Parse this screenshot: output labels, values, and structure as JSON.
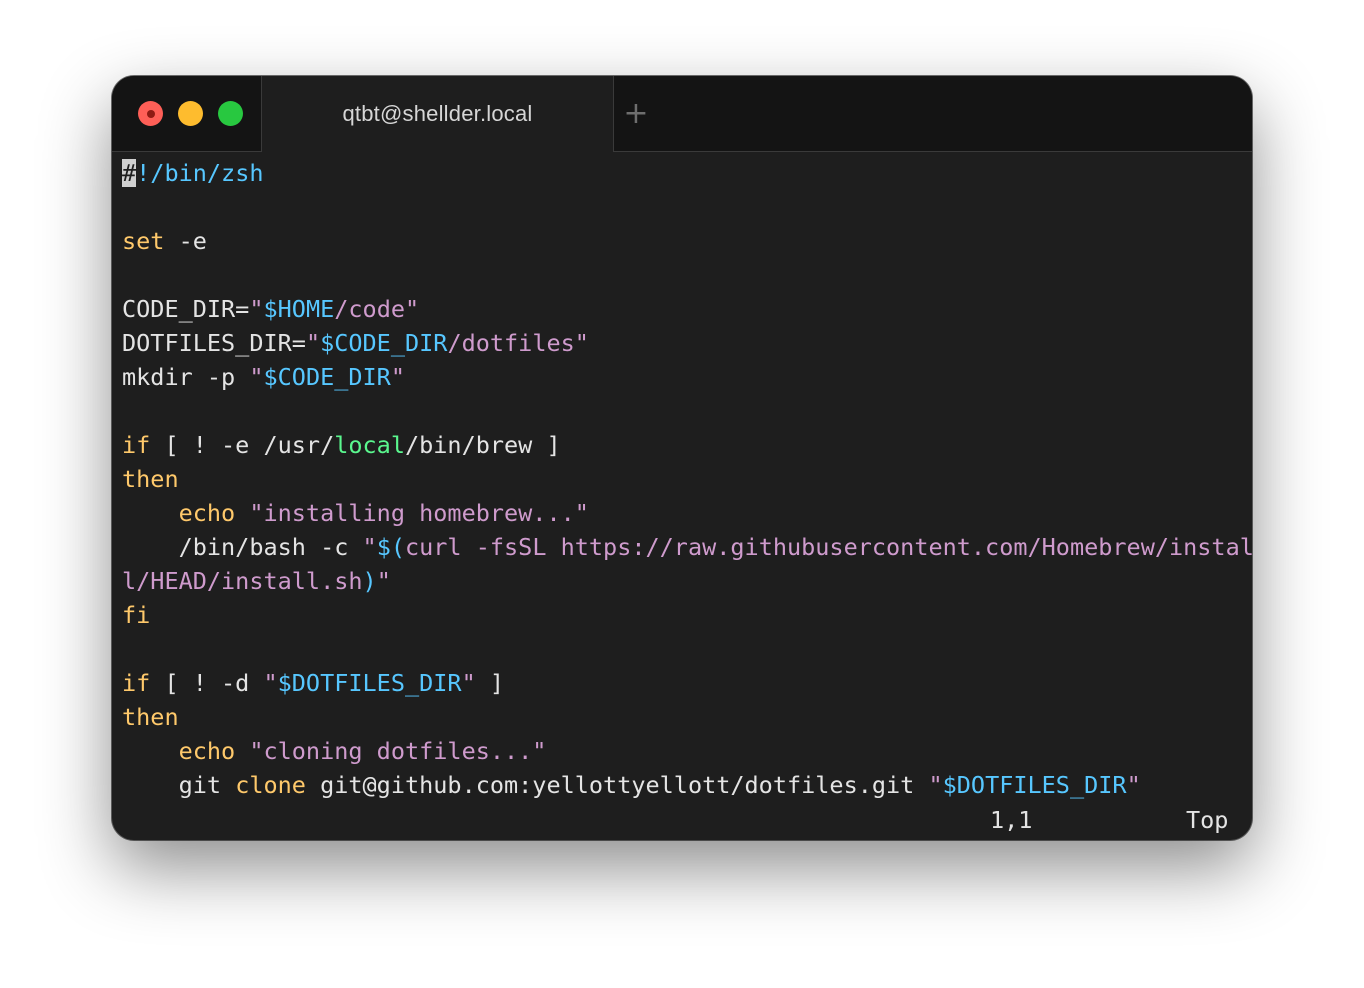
{
  "window": {
    "title": "qtbt@shellder.local",
    "controls": [
      "close",
      "minimize",
      "maximize"
    ],
    "new_tab_icon": "plus-icon"
  },
  "colors": {
    "background": "#1e1e1e",
    "keyword": "#ffc96b",
    "string": "#cf9bcd",
    "variable": "#57c7ff",
    "local": "#5af78e",
    "text": "#e4e4e4"
  },
  "editor": {
    "lines": [
      [
        {
          "t": "#",
          "c": "cursor"
        },
        {
          "t": "!/bin/zsh",
          "c": "var"
        }
      ],
      [],
      [
        {
          "t": "set",
          "c": "kw"
        },
        {
          "t": " -e"
        }
      ],
      [],
      [
        {
          "t": "CODE_DIR="
        },
        {
          "t": "\"",
          "c": "str"
        },
        {
          "t": "$HOME",
          "c": "var"
        },
        {
          "t": "/code\"",
          "c": "str"
        }
      ],
      [
        {
          "t": "DOTFILES_DIR="
        },
        {
          "t": "\"",
          "c": "str"
        },
        {
          "t": "$CODE_DIR",
          "c": "var"
        },
        {
          "t": "/dotfiles\"",
          "c": "str"
        }
      ],
      [
        {
          "t": "mkdir -p "
        },
        {
          "t": "\"",
          "c": "str"
        },
        {
          "t": "$CODE_DIR",
          "c": "var"
        },
        {
          "t": "\"",
          "c": "str"
        }
      ],
      [],
      [
        {
          "t": "if",
          "c": "kw"
        },
        {
          "t": " [ ! -e /usr/"
        },
        {
          "t": "local",
          "c": "lcl"
        },
        {
          "t": "/bin/brew ]"
        }
      ],
      [
        {
          "t": "then",
          "c": "kw"
        }
      ],
      [
        {
          "t": "    "
        },
        {
          "t": "echo",
          "c": "kw"
        },
        {
          "t": " "
        },
        {
          "t": "\"installing homebrew...\"",
          "c": "str"
        }
      ],
      [
        {
          "t": "    /bin/bash -c "
        },
        {
          "t": "\"",
          "c": "str"
        },
        {
          "t": "$(",
          "c": "var"
        },
        {
          "t": "curl -fsSL https://raw.githubusercontent.com/Homebrew/instal",
          "c": "str"
        }
      ],
      [
        {
          "t": "l/HEAD/install.sh",
          "c": "str"
        },
        {
          "t": ")",
          "c": "var"
        },
        {
          "t": "\"",
          "c": "str"
        }
      ],
      [
        {
          "t": "fi",
          "c": "kw"
        }
      ],
      [],
      [
        {
          "t": "if",
          "c": "kw"
        },
        {
          "t": " [ ! -d "
        },
        {
          "t": "\"",
          "c": "str"
        },
        {
          "t": "$DOTFILES_DIR",
          "c": "var"
        },
        {
          "t": "\"",
          "c": "str"
        },
        {
          "t": " ]"
        }
      ],
      [
        {
          "t": "then",
          "c": "kw"
        }
      ],
      [
        {
          "t": "    "
        },
        {
          "t": "echo",
          "c": "kw"
        },
        {
          "t": " "
        },
        {
          "t": "\"cloning dotfiles...\"",
          "c": "str"
        }
      ],
      [
        {
          "t": "    git "
        },
        {
          "t": "clone",
          "c": "kw"
        },
        {
          "t": " git@github.com:yellottyellott/dotfiles.git "
        },
        {
          "t": "\"",
          "c": "str"
        },
        {
          "t": "$DOTFILES_DIR",
          "c": "var"
        },
        {
          "t": "\"",
          "c": "str"
        }
      ]
    ]
  },
  "status": {
    "position": "1,1",
    "scroll": "Top"
  }
}
